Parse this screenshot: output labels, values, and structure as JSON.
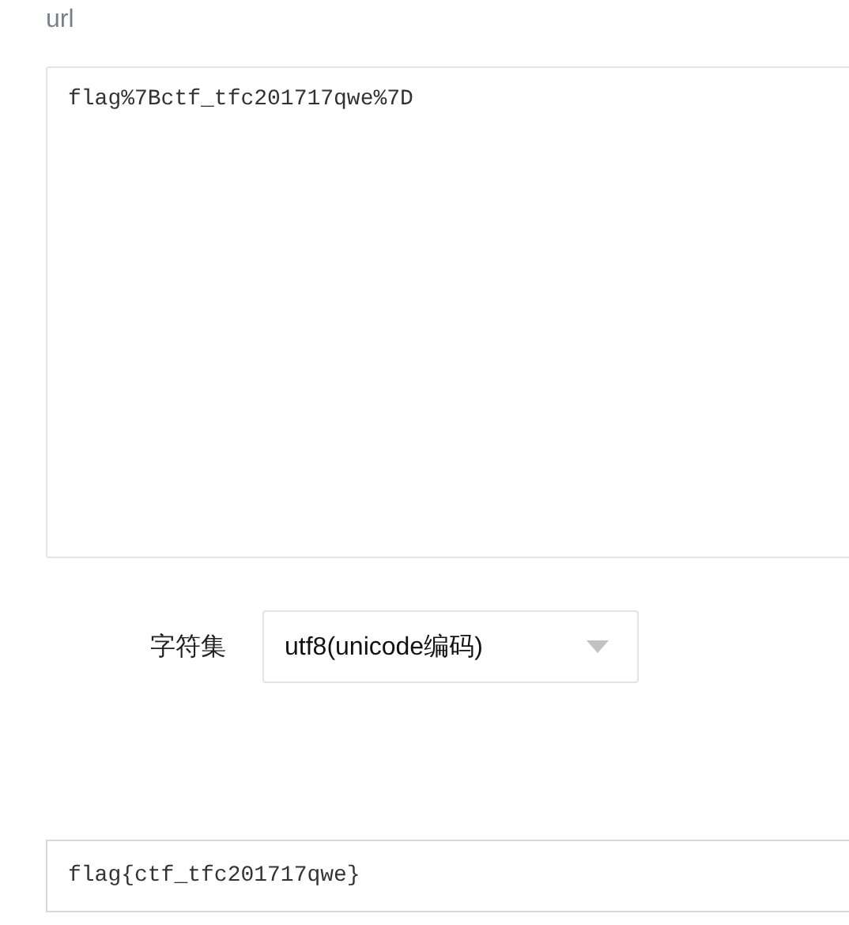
{
  "input": {
    "label": "url",
    "value": "flag%7Bctf_tfc201717qwe%7D"
  },
  "charset": {
    "label": "字符集",
    "value": "utf8(unicode编码)"
  },
  "output": {
    "value": "flag{ctf_tfc201717qwe}"
  }
}
